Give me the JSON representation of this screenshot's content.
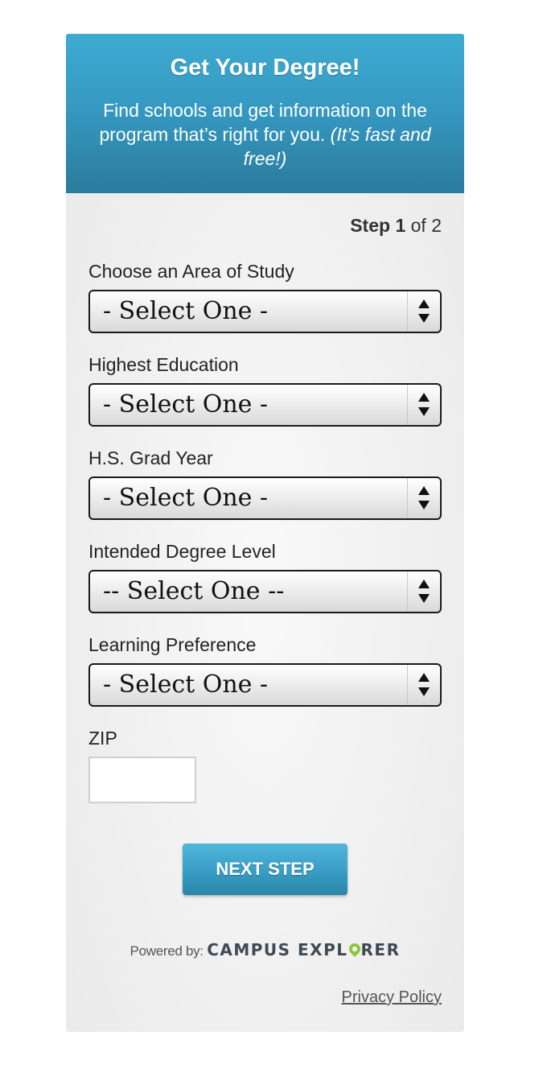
{
  "header": {
    "title": "Get Your Degree!",
    "subtitle_plain": "Find schools and get information on the program that’s right for you.",
    "subtitle_italic": "(It’s fast and free!)"
  },
  "step": {
    "label": "Step",
    "current": "1",
    "of_text": "of 2"
  },
  "fields": [
    {
      "label": "Choose an Area of Study",
      "value": "- Select One -"
    },
    {
      "label": "Highest Education",
      "value": "- Select One -"
    },
    {
      "label": "H.S. Grad Year",
      "value": "- Select One -"
    },
    {
      "label": "Intended Degree Level",
      "value": "-- Select One --"
    },
    {
      "label": "Learning Preference",
      "value": "- Select One -"
    }
  ],
  "zip": {
    "label": "ZIP",
    "value": ""
  },
  "next_button": "NEXT STEP",
  "powered": {
    "label": "Powered by:",
    "brand_part1": "CAMPUS EXPL",
    "brand_part2": "RER"
  },
  "privacy_link": "Privacy Policy",
  "colors": {
    "header_blue": "#3597bf",
    "button_blue": "#3aa0c8",
    "brand_green": "#8dc63f"
  }
}
